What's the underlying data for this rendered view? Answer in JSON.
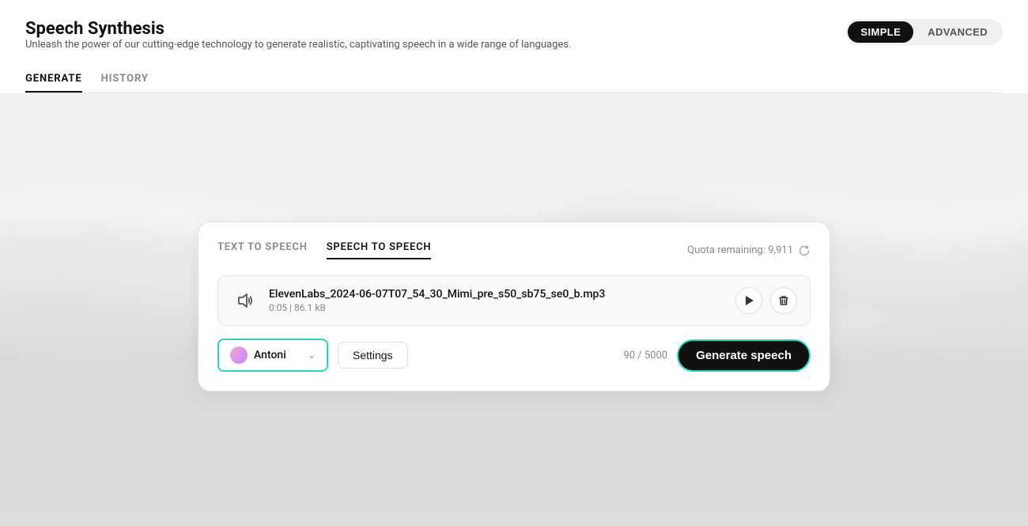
{
  "header": {
    "title": "Speech Synthesis",
    "subtitle": "Unleash the power of our cutting-edge technology to generate realistic, captivating speech in a wide range of languages.",
    "mode_simple": "SIMPLE",
    "mode_advanced": "ADVANCED"
  },
  "nav": {
    "tab_generate": "GENERATE",
    "tab_history": "HISTORY"
  },
  "card": {
    "tab_text_to_speech": "TEXT TO SPEECH",
    "tab_speech_to_speech": "SPEECH TO SPEECH",
    "quota_label": "Quota remaining: 9,911",
    "audio": {
      "filename": "ElevenLabs_2024-06-07T07_54_30_Mimi_pre_s50_sb75_se0_b.mp3",
      "duration": "0:05",
      "size": "86.1 kB",
      "meta_separator": "|"
    },
    "voice_name": "Antoni",
    "settings_label": "Settings",
    "char_count": "90 / 5000",
    "generate_label": "Generate speech"
  }
}
